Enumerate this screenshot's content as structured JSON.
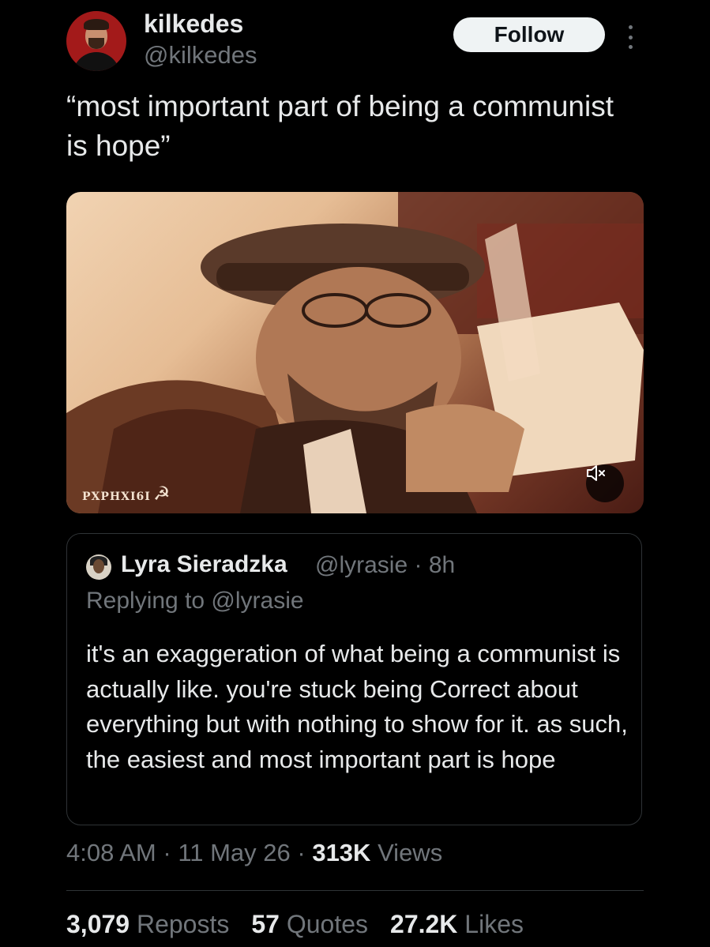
{
  "author": {
    "display_name": "kilkedes",
    "handle": "@kilkedes"
  },
  "follow_label": "Follow",
  "tweet": {
    "text": "“most important part of being a communist is hope”"
  },
  "media": {
    "watermark": "PXPHXI6I",
    "watermark_symbol": "☭",
    "mute_icon": "muted-speaker-icon"
  },
  "quoted": {
    "display_name": "Lyra Sieradzka",
    "handle": "@lyrasie",
    "time": "· 8h",
    "replying_to": "Replying to @lyrasie",
    "text": "it's an exaggeration of what being a communist is actually like. you're stuck being Correct about everything but with nothing to show for it. as such, the easiest and most important part is hope"
  },
  "meta": {
    "time": "4:08 AM",
    "date": "11 May 26",
    "views_count": "313K",
    "views_label": "Views"
  },
  "stats": {
    "reposts_count": "3,079",
    "reposts_label": "Reposts",
    "quotes_count": "57",
    "quotes_label": "Quotes",
    "likes_count": "27.2K",
    "likes_label": "Likes"
  },
  "colors": {
    "background": "#000000",
    "text_primary": "#e7e9ea",
    "text_secondary": "#71767b",
    "border": "#2f3336"
  }
}
